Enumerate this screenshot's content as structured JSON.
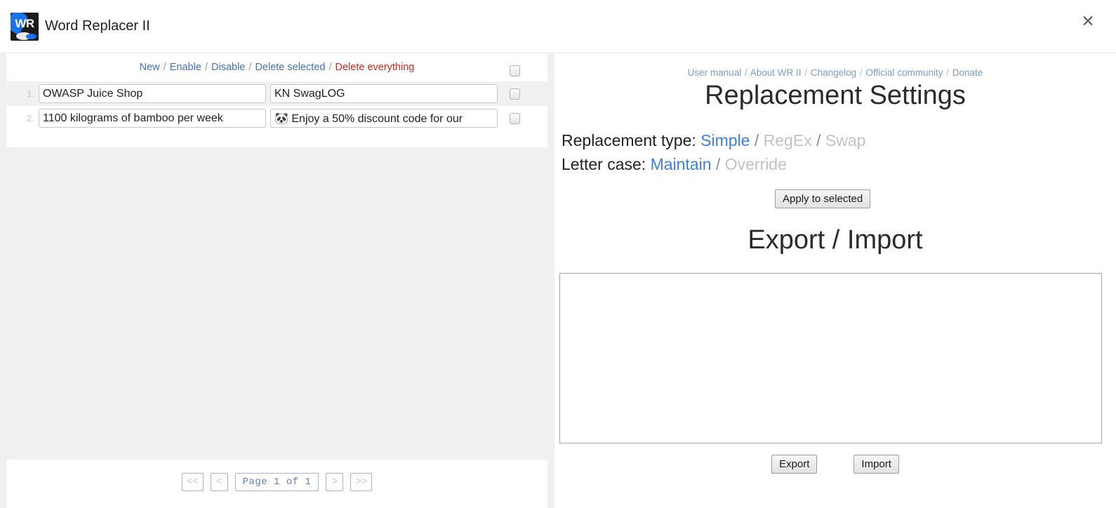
{
  "window": {
    "title": "Word Replacer II",
    "logo_text": "WR",
    "close_icon": "close-icon"
  },
  "left_panel": {
    "toolbar": {
      "actions": [
        {
          "label": "New",
          "style": "link"
        },
        {
          "label": "Enable",
          "style": "link"
        },
        {
          "label": "Disable",
          "style": "link"
        },
        {
          "label": "Delete selected",
          "style": "link"
        },
        {
          "label": "Delete everything",
          "style": "danger"
        }
      ],
      "separator": "/",
      "select_all_checked": false
    },
    "rows": [
      {
        "index": "1.",
        "from_value": "OWASP Juice Shop",
        "to_value": "KN SwagLOG",
        "checked": false
      },
      {
        "index": "2.",
        "from_value": "1100 kilograms of bamboo per week",
        "to_value": "🐼 Enjoy a 50% discount code for our",
        "checked": false
      }
    ],
    "pagination": {
      "first_label": "<<",
      "prev_label": "<",
      "page_label": "Page 1 of 1",
      "next_label": ">",
      "last_label": ">>"
    }
  },
  "right_panel": {
    "top_links": [
      "User manual",
      "About WR II",
      "Changelog",
      "Official community",
      "Donate"
    ],
    "link_separator": "/",
    "settings_heading": "Replacement Settings",
    "replacement_type": {
      "label": "Replacement type:",
      "options": [
        {
          "label": "Simple",
          "active": true
        },
        {
          "label": "RegEx",
          "active": false
        },
        {
          "label": "Swap",
          "active": false
        }
      ],
      "selected": "Simple"
    },
    "letter_case": {
      "label": "Letter case:",
      "options": [
        {
          "label": "Maintain",
          "active": true
        },
        {
          "label": "Override",
          "active": false
        }
      ],
      "selected": "Maintain"
    },
    "apply_button": "Apply to selected",
    "export_heading": "Export / Import",
    "io_textarea_value": "",
    "export_button": "Export",
    "import_button": "Import"
  },
  "colors": {
    "link_blue": "#4472c4",
    "danger_red": "#d2291e",
    "active_option": "#3d7fd8",
    "inactive_option": "#c2c2c2",
    "panel_grey": "#f0f0f0"
  }
}
